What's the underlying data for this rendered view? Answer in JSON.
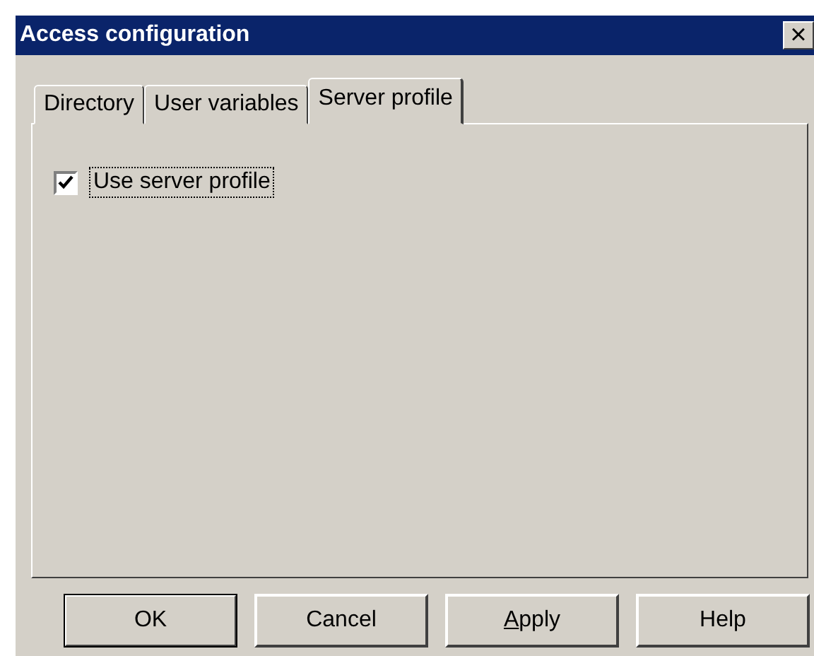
{
  "window": {
    "title": "Access configuration",
    "close": "×"
  },
  "tabs": [
    {
      "label": "Directory",
      "selected": false
    },
    {
      "label": "User variables",
      "selected": false
    },
    {
      "label": "Server profile",
      "selected": true
    }
  ],
  "options": [
    {
      "label": "Use server profile",
      "checked": true,
      "focused": true
    }
  ],
  "buttons": [
    {
      "label": "OK",
      "default": true
    },
    {
      "label": "Cancel",
      "default": false
    },
    {
      "label": "Apply",
      "default": false,
      "access_key_underlined": true
    },
    {
      "label": "Help",
      "default": false
    }
  ]
}
